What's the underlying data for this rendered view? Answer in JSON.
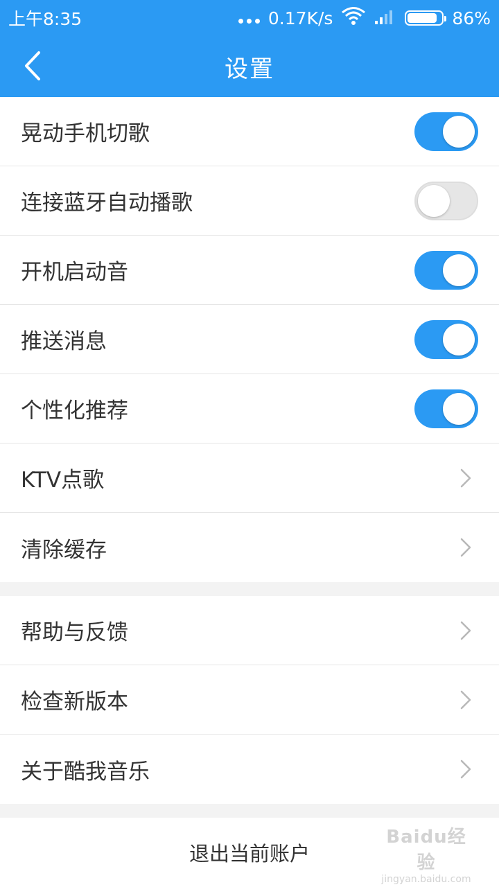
{
  "status_bar": {
    "time": "上午8:35",
    "network_speed": "0.17K/s",
    "battery_percent": "86%",
    "battery_level": 0.86,
    "icons": [
      "more-dots-icon",
      "wifi-icon",
      "signal-icon",
      "battery-icon"
    ]
  },
  "nav": {
    "title": "设置",
    "back_icon": "chevron-left-icon"
  },
  "settings_group1": [
    {
      "label": "晃动手机切歌",
      "type": "toggle",
      "on": true
    },
    {
      "label": "连接蓝牙自动播歌",
      "type": "toggle",
      "on": false
    },
    {
      "label": "开机启动音",
      "type": "toggle",
      "on": true
    },
    {
      "label": "推送消息",
      "type": "toggle",
      "on": true
    },
    {
      "label": "个性化推荐",
      "type": "toggle",
      "on": true
    },
    {
      "label": "KTV点歌",
      "type": "link"
    },
    {
      "label": "清除缓存",
      "type": "link"
    }
  ],
  "settings_group2": [
    {
      "label": "帮助与反馈",
      "type": "link"
    },
    {
      "label": "检查新版本",
      "type": "link"
    },
    {
      "label": "关于酷我音乐",
      "type": "link"
    }
  ],
  "logout": {
    "label": "退出当前账户"
  },
  "watermark": {
    "logo": "Baidu经验",
    "url": "jingyan.baidu.com"
  },
  "colors": {
    "accent": "#2b9af3",
    "text": "#333333",
    "divider": "#e6e6e6",
    "background": "#f3f3f3"
  }
}
